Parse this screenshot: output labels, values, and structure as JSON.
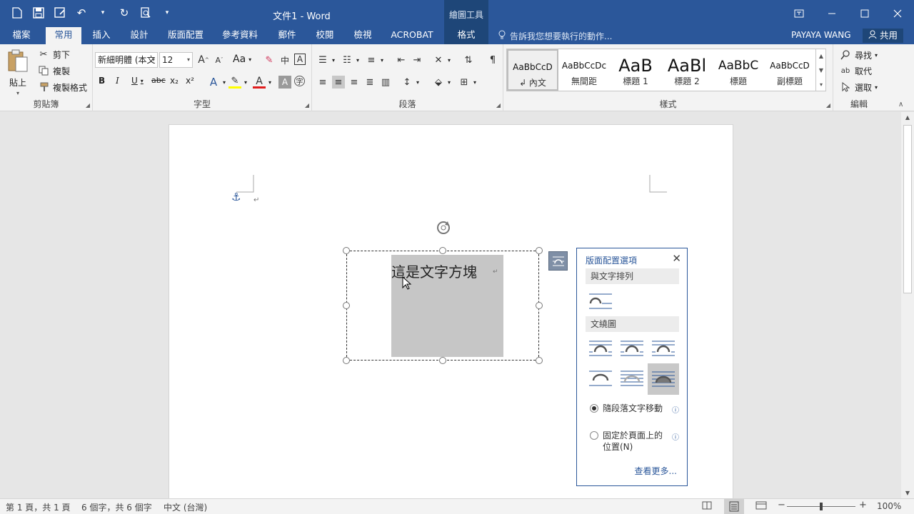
{
  "titlebar": {
    "title": "文件1 - Word",
    "tools_label": "繪圖工具",
    "qat": [
      "save-icon",
      "save-as-icon",
      "undo-icon",
      "redo-icon",
      "print-preview-icon",
      "customize-icon"
    ],
    "window_buttons": [
      "ribbon-display-icon",
      "minimize-icon",
      "maximize-icon",
      "close-icon"
    ]
  },
  "tabs": {
    "file": "檔案",
    "home": "常用",
    "insert": "插入",
    "design": "設計",
    "layout": "版面配置",
    "references": "參考資料",
    "mailings": "郵件",
    "review": "校閱",
    "view": "檢視",
    "acrobat": "ACROBAT",
    "format": "格式"
  },
  "tellme": "告訴我您想要執行的動作...",
  "user": "PAYAYA WANG",
  "share": "共用",
  "clipboard": {
    "paste": "貼上",
    "cut": "剪下",
    "copy": "複製",
    "format_painter": "複製格式",
    "label": "剪貼簿"
  },
  "font": {
    "name": "新細明體 (本文",
    "size": "12",
    "label": "字型",
    "aa": "Aa",
    "bold": "B",
    "italic": "I",
    "underline": "U",
    "strike": "abc",
    "sub": "x₂",
    "sup": "x²"
  },
  "paragraph": {
    "label": "段落"
  },
  "styles": {
    "label": "樣式",
    "items": [
      {
        "preview": "AaBbCcD",
        "name": "↲ 內文"
      },
      {
        "preview": "AaBbCcDc",
        "name": "無間距"
      },
      {
        "preview": "AaB",
        "name": "標題 1"
      },
      {
        "preview": "AaBl",
        "name": "標題 2"
      },
      {
        "preview": "AaBbC",
        "name": "標題"
      },
      {
        "preview": "AaBbCcD",
        "name": "副標題"
      }
    ]
  },
  "editing": {
    "find": "尋找",
    "replace": "取代",
    "select": "選取",
    "label": "編輯"
  },
  "document": {
    "textbox_text": "這是文字方塊",
    "para_mark": "↵"
  },
  "layout_panel": {
    "title": "版面配置選項",
    "inline_section": "與文字排列",
    "wrap_section": "文繞圖",
    "move_with_text": "隨段落文字移動",
    "fix_position": "固定於頁面上的位置(N)",
    "see_more": "查看更多..."
  },
  "status": {
    "page": "第 1 頁，共 1 頁",
    "words": "6 個字，共 6 個字",
    "lang": "中文 (台灣)",
    "zoom": "100%",
    "zoom_level": 1.0
  }
}
